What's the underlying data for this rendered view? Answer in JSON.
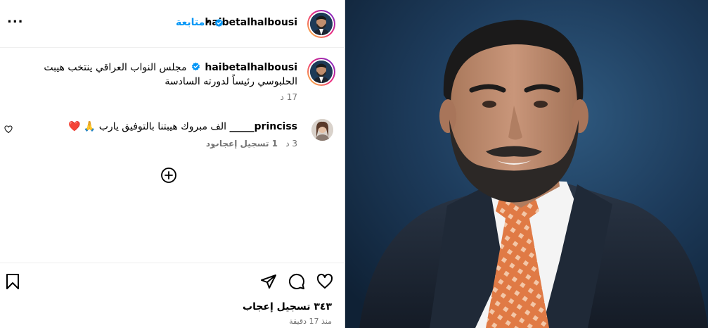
{
  "header": {
    "username": "haibetalhalbousi",
    "follow_label": "متابعة",
    "separator": "•",
    "more_label": "..."
  },
  "caption": {
    "username": "haibetalhalbousi",
    "text": "مجلس النواب العراقي ينتخب هيبت الحلبوسي رئيساً لدورته السادسة",
    "time": "17 د"
  },
  "comment": {
    "username": "princiss_____",
    "text": "الف مبروك هيبتنا بالتوفيق يارب 🙏 ❤️",
    "time": "3 د",
    "likes": "1 تسجيل إعجاب",
    "reply_label": "رد"
  },
  "actions": {
    "like_icon": "heart-icon",
    "comment_icon": "comment-icon",
    "share_icon": "send-icon",
    "save_icon": "bookmark-icon",
    "load_more_icon": "plus-circle-icon"
  },
  "footer": {
    "likes": "٣٤٣ تسجيل إعجاب",
    "time": "منذ 17 دقيقة"
  },
  "colors": {
    "accent": "#0095f6",
    "verified": "#0095f6",
    "heart_red": "#e0245e",
    "photo_bg": "#1e3c5c"
  }
}
